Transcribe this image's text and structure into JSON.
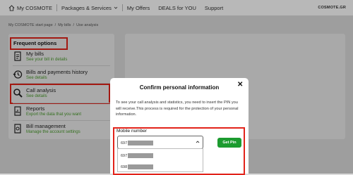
{
  "nav": {
    "home_label": "My COSMOTE",
    "items": [
      "Packages & Services",
      "My Offers",
      "DEALS for YOU",
      "Support"
    ],
    "brand": "COSMOTE.GR"
  },
  "breadcrumb": [
    "My COSMOTE start page",
    "My bills",
    "Use analysis"
  ],
  "sidebar": {
    "title": "Frequent options",
    "items": [
      {
        "title": "My bills",
        "subtitle": "See your bill in details",
        "icon": "bill-icon"
      },
      {
        "title": "Bills and payments history",
        "subtitle": "See details",
        "icon": "history-icon"
      },
      {
        "title": "Call analysis",
        "subtitle": "See details",
        "icon": "search-icon"
      },
      {
        "title": "Reports",
        "subtitle": "Export the data that you want",
        "icon": "reports-icon"
      },
      {
        "title": "Bill management",
        "subtitle": "Manage the account settings",
        "icon": "settings-icon"
      }
    ]
  },
  "modal": {
    "title": "Confirm personal information",
    "text": "To see your call analysis and statistics, you need to insert the PIN you will receive.This process is required for the protection of your personal information.",
    "mobile_label": "Mobile number",
    "selected_value": "697",
    "options": [
      "697",
      "698"
    ],
    "get_pin_label": "Get Pin"
  },
  "colors": {
    "accent_green": "#1c9b2f",
    "highlight_red": "#e2231a",
    "subtitle_green": "#4a9c2d"
  }
}
